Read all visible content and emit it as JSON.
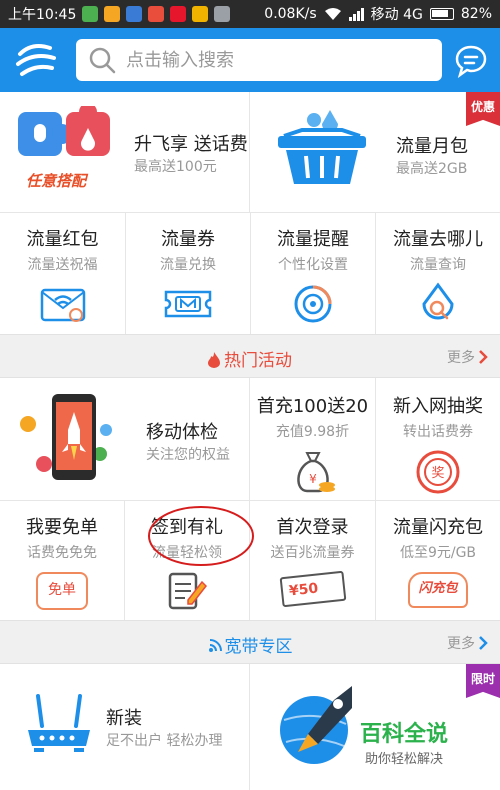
{
  "status_bar": {
    "time": "上午10:45",
    "network_speed": "0.08K/s",
    "carrier": "移动 4G",
    "battery": "82%"
  },
  "header": {
    "search_placeholder": "点击输入搜索"
  },
  "promo_row": [
    {
      "title": "升飞享 送话费",
      "subtitle": "最高送100元",
      "image_caption": "任意搭配"
    },
    {
      "title": "流量月包",
      "subtitle": "最高送2GB",
      "badge": "优惠"
    }
  ],
  "quick_services": [
    {
      "title": "流量红包",
      "subtitle": "流量送祝福"
    },
    {
      "title": "流量券",
      "subtitle": "流量兑换"
    },
    {
      "title": "流量提醒",
      "subtitle": "个性化设置"
    },
    {
      "title": "流量去哪儿",
      "subtitle": "流量查询"
    }
  ],
  "hot_section": {
    "title": "热门活动",
    "more": "更多"
  },
  "hot_feature": {
    "title": "移动体检",
    "subtitle": "关注您的权益"
  },
  "hot_top": [
    {
      "title": "首充100送20",
      "subtitle": "充值9.98折"
    },
    {
      "title": "新入网抽奖",
      "subtitle": "转出话费券"
    }
  ],
  "hot_bottom": [
    {
      "title": "我要免单",
      "subtitle": "话费免免免",
      "icon_text": "免单"
    },
    {
      "title": "签到有礼",
      "subtitle": "流量轻松领"
    },
    {
      "title": "首次登录",
      "subtitle": "送百兆流量券",
      "icon_text": "¥50"
    },
    {
      "title": "流量闪充包",
      "subtitle": "低至9元/GB",
      "icon_text": "闪充包"
    }
  ],
  "broadband_section": {
    "title": "宽带专区",
    "more": "更多"
  },
  "broadband": [
    {
      "title": "新装",
      "subtitle": "足不出户 轻松办理"
    },
    {
      "badge": "限时"
    }
  ],
  "watermark": {
    "title": "百科全说",
    "subtitle": "助你轻松解决"
  },
  "colors": {
    "brand_blue": "#1e8fe8",
    "hot_red": "#e74c3c",
    "badge_red": "#d9303a",
    "badge_purple": "#9b2fae"
  }
}
